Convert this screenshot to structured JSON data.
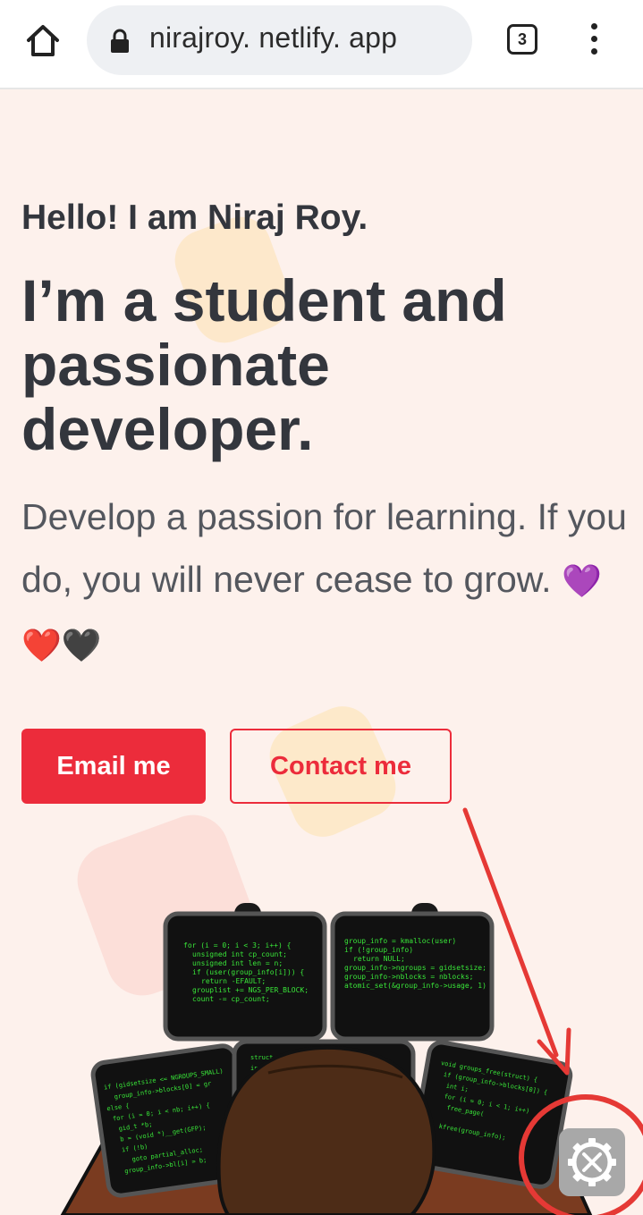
{
  "browser": {
    "url": "nirajroy. netlify. app",
    "tab_count": "3",
    "icons": {
      "home": "home-icon",
      "lock": "lock-icon",
      "menu": "more-vert-icon"
    }
  },
  "hero": {
    "greeting": "Hello! I am Niraj Roy.",
    "headline": "I’m a student and passionate developer.",
    "tagline": "Develop a passion for learning. If you do, you will never cease to grow.",
    "emojis": "💜❤️🖤"
  },
  "buttons": {
    "email": "Email me",
    "contact": "Contact me"
  },
  "floating": {
    "settings_icon": "settings-tools-icon"
  },
  "colors": {
    "accent": "#ec2c3b",
    "background": "#fdf1ec",
    "text": "#33363d",
    "annotation": "#e53935"
  }
}
